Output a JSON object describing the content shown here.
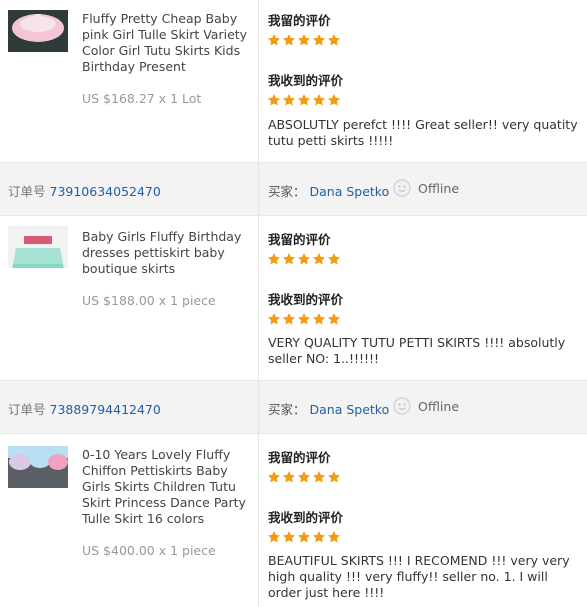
{
  "orders": [
    {
      "product_title": "Fluffy Pretty Cheap Baby pink Girl Tulle Skirt Variety Color Girl Tutu Skirts Kids Birthday Present",
      "price": "US $168.27 x 1 Lot",
      "left_review_heading": "我留的评价",
      "left_rating": 5,
      "received_review_heading": "我收到的评价",
      "received_rating": 5,
      "review_text": "ABSOLUTLY perefct !!!! Great seller!! very quatity tutu petti skirts !!!!!",
      "thumb_colors": [
        "#f3c6d6",
        "#f7e3ea",
        "#2f3a3b"
      ]
    },
    {
      "product_title": "Baby Girls Fluffy Birthday dresses pettiskirt baby boutique skirts",
      "price": "US $188.00 x 1 piece",
      "left_review_heading": "我留的评价",
      "left_rating": 5,
      "received_review_heading": "我收到的评价",
      "received_rating": 5,
      "review_text": "VERY QUALITY TUTU PETTI SKIRTS !!!! absolutly seller NO: 1..!!!!!!",
      "thumb_colors": [
        "#8ad6c6",
        "#f2f2f2",
        "#d95c74"
      ]
    },
    {
      "product_title": "0-10 Years Lovely Fluffy Chiffon Pettiskirts Baby Girls Skirts Children Tutu Skirt Princess Dance Party Tulle Skirt 16 colors",
      "price": "US $400.00 x 1 piece",
      "left_review_heading": "我留的评价",
      "left_rating": 5,
      "received_review_heading": "我收到的评价",
      "received_rating": 5,
      "review_text": "BEAUTIFUL SKIRTS !!! I RECOMEND !!! very very high quality !!! very fluffy!! seller no. 1. I will order just here !!!!",
      "thumb_colors": [
        "#d9c9e6",
        "#b8e0f2",
        "#f0a2c0"
      ]
    }
  ],
  "bars": [
    {
      "order_label": "订单号",
      "order_number": "73910634052470",
      "buyer_label": "买家：",
      "buyer_name": "Dana Spetko",
      "status": "Offline"
    },
    {
      "order_label": "订单号",
      "order_number": "73889794412470",
      "buyer_label": "买家：",
      "buyer_name": "Dana Spetko",
      "status": "Offline"
    }
  ],
  "colors": {
    "star": "#f39c12",
    "link": "#1f5fa8",
    "bar_bg": "#f3f3f3"
  },
  "icons": {
    "chat": "chat-smiley-icon",
    "star": "star-icon"
  }
}
